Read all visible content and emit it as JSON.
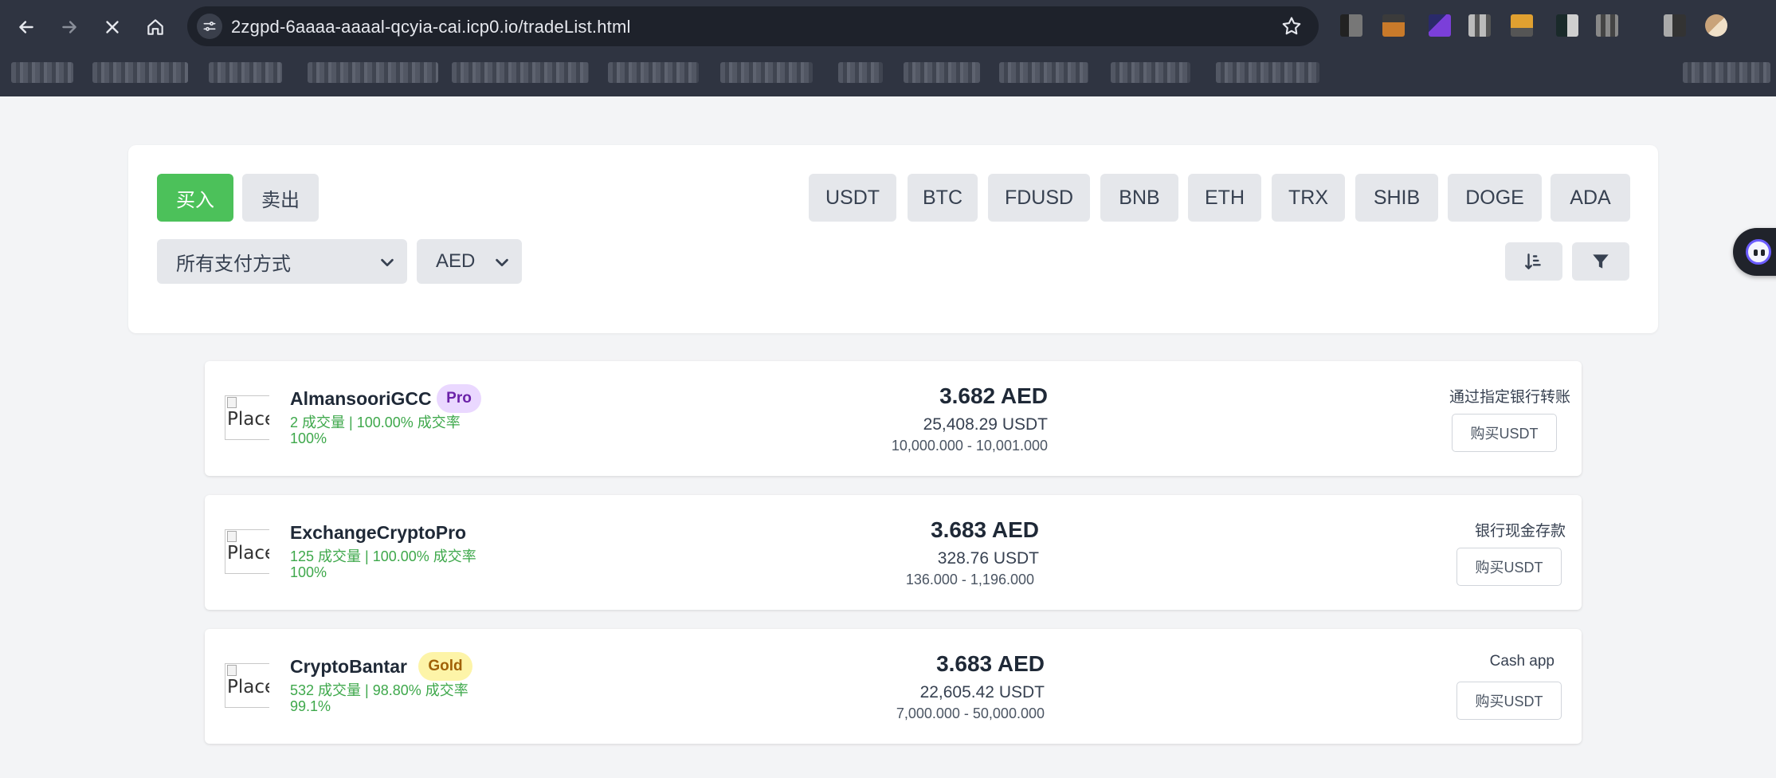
{
  "browser": {
    "url": "2zgpd-6aaaa-aaaal-qcyia-cai.icp0.io/tradeList.html"
  },
  "icons": {
    "back": "arrow-left-icon",
    "forward": "arrow-right-icon",
    "stop": "close-icon",
    "home": "home-icon",
    "site_info": "tune-icon",
    "bookmark": "star-icon",
    "sort": "sort-amount-icon",
    "filter": "funnel-icon",
    "select": "chevron-down-icon"
  },
  "trade_tabs": {
    "buy": "买入",
    "sell": "卖出"
  },
  "coins": [
    "USDT",
    "BTC",
    "FDUSD",
    "BNB",
    "ETH",
    "TRX",
    "SHIB",
    "DOGE",
    "ADA"
  ],
  "filters": {
    "payment_method": "所有支付方式",
    "currency": "AED"
  },
  "avatar_alt": "Placeholder",
  "listings": [
    {
      "name": "AlmansooriGCC",
      "badge": "Pro",
      "stats": "2 成交量 | 100.00% 成交率",
      "rate": "100%",
      "price": "3.682 AED",
      "available": "25,408.29 USDT",
      "limits": "10,000.000 - 10,001.000",
      "payment": "通过指定银行转账",
      "button": "购买USDT"
    },
    {
      "name": "ExchangeCryptoPro",
      "badge": "",
      "stats": "125 成交量 | 100.00% 成交率",
      "rate": "100%",
      "price": "3.683 AED",
      "available": "328.76 USDT",
      "limits": "136.000 - 1,196.000",
      "payment": "银行现金存款",
      "button": "购买USDT"
    },
    {
      "name": "CryptoBantar",
      "badge": "Gold",
      "stats": "532 成交量 | 98.80% 成交率",
      "rate": "99.1%",
      "price": "3.683 AED",
      "available": "22,605.42 USDT",
      "limits": "7,000.000 - 50,000.000",
      "payment": "Cash app",
      "button": "购买USDT"
    }
  ],
  "colors": {
    "buy_green": "#4cc15a",
    "stats_green": "#3ea84b",
    "pro_badge_bg": "#ead8ff",
    "gold_badge_bg": "#fdf4a8"
  }
}
